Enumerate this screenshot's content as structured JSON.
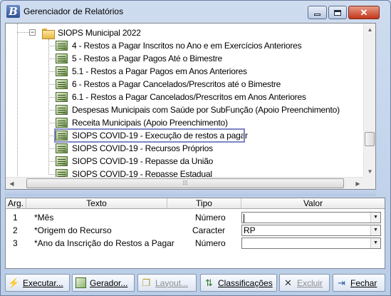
{
  "window": {
    "title": "Gerenciador de Relatórios",
    "icon_letter": "B",
    "icon": "app-icon"
  },
  "tree": {
    "group_label": "SIOPS Municipal 2022",
    "expander_glyph": "−",
    "items": [
      {
        "label": "4 - Restos a Pagar Inscritos no Ano e em Exercícios Anteriores"
      },
      {
        "label": "5 - Restos a Pagar Pagos Até o Bimestre"
      },
      {
        "label": "5.1 - Restos a Pagar Pagos em Anos Anteriores"
      },
      {
        "label": "6 - Restos a Pagar Cancelados/Prescritos até o Bimestre"
      },
      {
        "label": "6.1 - Restos a Pagar Cancelados/Prescritos em Anos Anteriores"
      },
      {
        "label": "Despesas Municipais com Saúde por SubFunção (Apoio Preenchimento)"
      },
      {
        "label": "Receita Municipais (Apoio Preenchimento)"
      },
      {
        "label": "SIOPS COVID-19 - Execução de restos a pagar",
        "selected": true
      },
      {
        "label": "SIOPS COVID-19 - Recursos Próprios"
      },
      {
        "label": "SIOPS COVID-19 - Repasse da União"
      },
      {
        "label": "SIOPS COVID-19 - Repasse Estadual"
      }
    ]
  },
  "grid": {
    "headers": {
      "arg": "Arg.",
      "texto": "Texto",
      "tipo": "Tipo",
      "valor": "Valor"
    },
    "rows": [
      {
        "arg": "1",
        "texto": "*Mês",
        "tipo": "Número",
        "valor": ""
      },
      {
        "arg": "2",
        "texto": "*Origem do Recurso",
        "tipo": "Caracter",
        "valor": "RP"
      },
      {
        "arg": "3",
        "texto": "*Ano da Inscrição do Restos a Pagar",
        "tipo": "Número",
        "valor": ""
      }
    ]
  },
  "toolbar": {
    "executar": "Executar...",
    "gerador": "Gerador...",
    "layout": "Layout...",
    "classificacoes": "Classificações",
    "excluir": "Excluir",
    "fechar": "Fechar"
  },
  "colors": {
    "selection_border": "#7f86c4",
    "close_button": "#c4361c"
  }
}
